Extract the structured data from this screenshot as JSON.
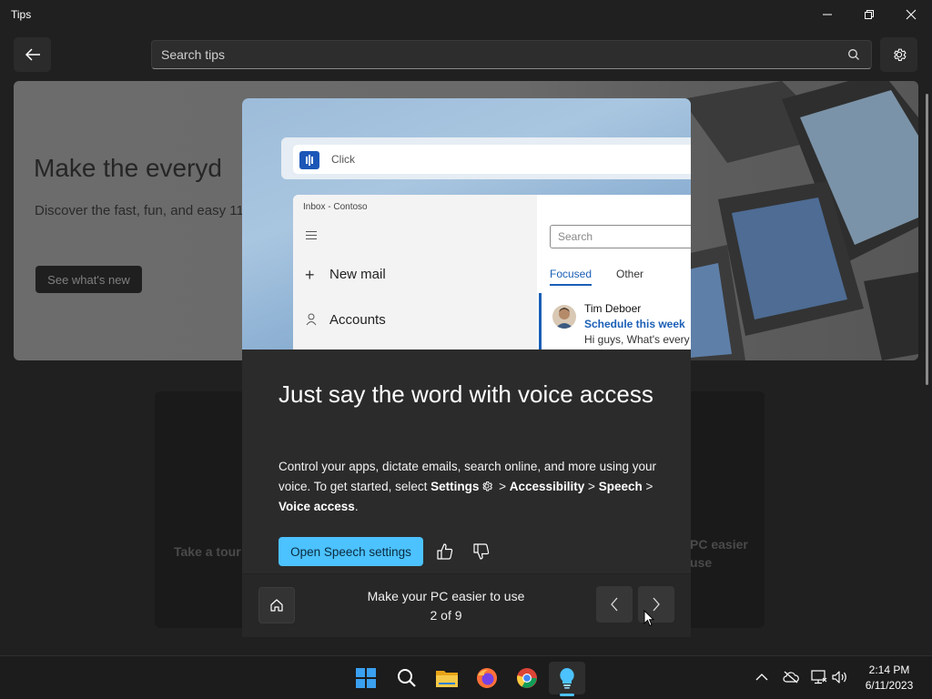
{
  "window": {
    "title": "Tips"
  },
  "search": {
    "placeholder": "Search tips"
  },
  "hero": {
    "title": "Make the everyd",
    "description": "Discover the fast, fun, and easy 11.",
    "button_label": "See what's new"
  },
  "background_cards": {
    "card1_text": "Take a tour",
    "card2_text": "PC easier use"
  },
  "dialog": {
    "image": {
      "voice_bar_text": "Click",
      "mail": {
        "inbox_label": "Inbox - Contoso",
        "new_mail": "New mail",
        "accounts": "Accounts",
        "search_placeholder": "Search",
        "tab_focused": "Focused",
        "tab_other": "Other",
        "message_from": "Tim Deboer",
        "message_subject": "Schedule this week",
        "message_preview": "Hi guys, What's every"
      }
    },
    "title": "Just say the word with voice access",
    "body_part1": "Control your apps, dictate emails, search online, and more using your voice. To get started, select ",
    "body_settings": "Settings",
    "body_sep1": " > ",
    "body_accessibility": "Accessibility",
    "body_sep2": " > ",
    "body_speech": "Speech",
    "body_sep3": " > ",
    "body_voice_access": "Voice access",
    "body_end": ".",
    "primary_button": "Open Speech settings",
    "footer": {
      "collection_title": "Make your PC easier to use",
      "page_indicator": "2 of 9"
    }
  },
  "taskbar": {
    "apps": [
      "start-icon",
      "search-icon",
      "file-explorer-icon",
      "firefox-icon",
      "chrome-icon",
      "tips-icon"
    ],
    "active_app": "tips-icon",
    "clock_time": "2:14 PM",
    "clock_date": "6/11/2023"
  },
  "colors": {
    "accent": "#4cc2ff",
    "background": "#202020",
    "dialog": "#2b2b2b"
  }
}
